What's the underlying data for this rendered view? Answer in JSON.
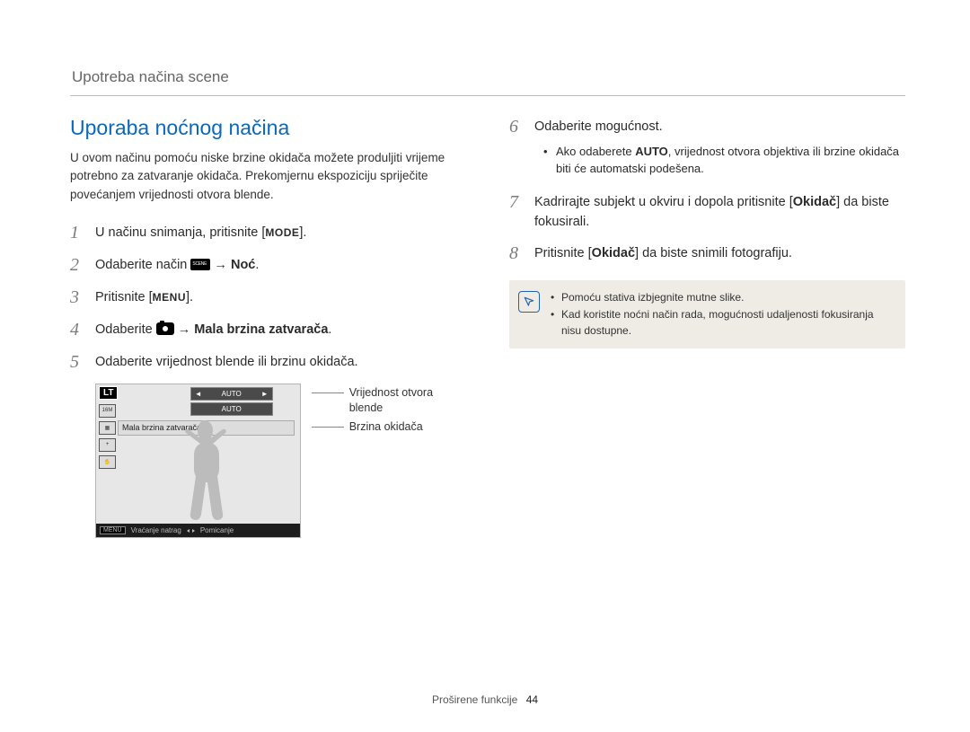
{
  "header": {
    "breadcrumb": "Upotreba načina scene"
  },
  "section_title": "Uporaba noćnog načina",
  "intro": "U ovom načinu pomoću niske brzine okidača možete produljiti vrijeme potrebno za zatvaranje okidača. Prekomjernu ekspoziciju spriječite povećanjem vrijednosti otvora blende.",
  "left_steps": [
    {
      "num": "1",
      "pre": "U načinu snimanja, pritisnite [",
      "button": "MODE",
      "post": "]."
    },
    {
      "num": "2",
      "pre": "Odaberite način ",
      "icon": "scene",
      "arrow": " → ",
      "bold_after": "Noć",
      "post": "."
    },
    {
      "num": "3",
      "pre": "Pritisnite [",
      "button": "MENU",
      "post": "]."
    },
    {
      "num": "4",
      "pre": "Odaberite ",
      "icon": "camera",
      "arrow": " → ",
      "bold_after": "Mala brzina zatvarača",
      "post": "."
    },
    {
      "num": "5",
      "pre": "Odaberite vrijednost blende ili brzinu okidača."
    }
  ],
  "right_steps": [
    {
      "num": "6",
      "pre": "Odaberite mogućnost.",
      "bullets": [
        {
          "parts": [
            "Ako odaberete ",
            {
              "bold": "AUTO"
            },
            ", vrijednost otvora objektiva ili brzine okidača biti će automatski podešena."
          ]
        }
      ]
    },
    {
      "num": "7",
      "parts": [
        "Kadrirajte subjekt u okviru i dopola pritisnite [",
        {
          "bold": "Okidač"
        },
        "] da biste fokusirali."
      ]
    },
    {
      "num": "8",
      "parts": [
        "Pritisnite [",
        {
          "bold": "Okidač"
        },
        "] da biste snimili fotografiju."
      ]
    }
  ],
  "display": {
    "corner": "LT",
    "dropdown1": "AUTO",
    "dropdown2": "AUTO",
    "label_bar": "Mala brzina zatvarača",
    "bottom_menu": "MENU",
    "bottom_back": "Vraćanje natrag",
    "bottom_move": "Pomicanje"
  },
  "callouts": {
    "c1": "Vrijednost otvora blende",
    "c2": "Brzina okidača"
  },
  "note": {
    "items": [
      "Pomoću stativa izbjegnite mutne slike.",
      "Kad koristite noćni način rada, mogućnosti udaljenosti fokusiranja nisu dostupne."
    ]
  },
  "footer": {
    "section": "Proširene funkcije",
    "page": "44"
  }
}
